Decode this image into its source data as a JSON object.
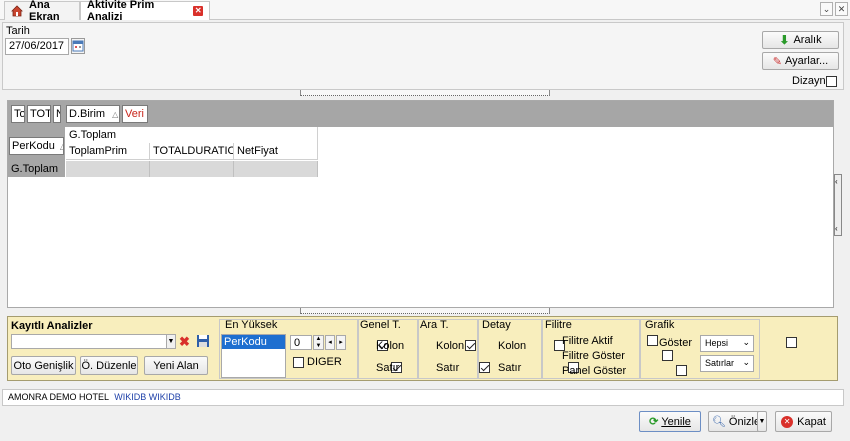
{
  "tabs": {
    "home": "Ana Ekran",
    "active": "Aktivite Prim Analizi"
  },
  "filter": {
    "date_label": "Tarih",
    "date_value": "27/06/2017"
  },
  "top_buttons": {
    "range": "Aralık",
    "settings": "Ayarlar...",
    "design_label": "Dizayn"
  },
  "pivot": {
    "header_fields": [
      "To",
      "TOT",
      "N",
      "D.Birim",
      "Veri"
    ],
    "row_field": "PerKodu",
    "col_group": "G.Toplam",
    "columns": [
      "ToplamPrim",
      "TOTALDURATION",
      "NetFiyat"
    ],
    "row_total": "G.Toplam"
  },
  "saved": {
    "title": "Kayıtlı Analizler",
    "btn_autowidth": "Oto Genişlik",
    "btn_edit": "Ö. Düzenle",
    "btn_new": "Yeni Alan"
  },
  "top_n": {
    "title": "En Yüksek",
    "list_item": "PerKodu",
    "count": "0",
    "other_label": "DIGER"
  },
  "totals": {
    "general": {
      "title": "Genel T.",
      "col": "Kolon",
      "row": "Satır",
      "col_checked": true,
      "row_checked": true
    },
    "sub": {
      "title": "Ara T.",
      "col": "Kolon",
      "row": "Satır",
      "col_checked": true,
      "row_checked": true
    },
    "detail": {
      "title": "Detay",
      "col": "Kolon",
      "row": "Satır",
      "col_checked": false,
      "row_checked": false
    }
  },
  "filters": {
    "title": "Filitre",
    "active": "Filitre Aktif",
    "show": "Filitre Göster",
    "panel": "Panel Göster"
  },
  "chart": {
    "title": "Grafik",
    "show": "Göster",
    "sel1": "Hepsi",
    "sel2": "Satırlar"
  },
  "status": {
    "hotel": "AMONRA DEMO HOTEL",
    "db": "WIKIDB WIKIDB"
  },
  "footer": {
    "refresh": "Yenile",
    "preview": "Önizle",
    "close": "Kapat"
  },
  "colors": {
    "panel_yellow": "#f8eebd",
    "grid_header": "#a6a6a6",
    "accent_red": "#d9302a",
    "accent_green": "#2a9a2a"
  }
}
